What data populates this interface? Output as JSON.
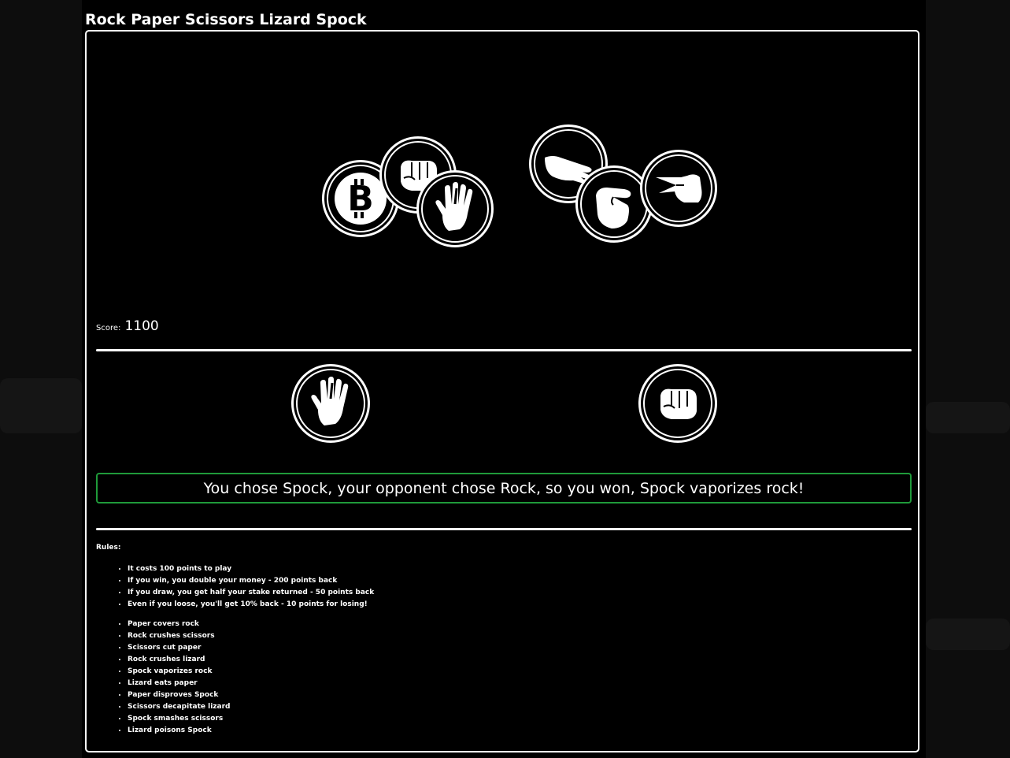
{
  "page": {
    "title": "Rock Paper Scissors Lizard Spock"
  },
  "choices": [
    {
      "name": "Bitcoin",
      "icon": "bitcoin-icon"
    },
    {
      "name": "Rock",
      "icon": "rock-fist-icon"
    },
    {
      "name": "Spock",
      "icon": "spock-hand-icon"
    },
    {
      "name": "Paper",
      "icon": "paper-hand-icon"
    },
    {
      "name": "Lizard",
      "icon": "lizard-hand-icon"
    },
    {
      "name": "Scissors",
      "icon": "scissors-hand-icon"
    }
  ],
  "score": {
    "label": "Score:",
    "value": "1100"
  },
  "round": {
    "player_choice_icon": "spock-hand-icon",
    "opponent_choice_icon": "rock-fist-icon",
    "result_message": "You chose Spock, your opponent chose Rock, so you won, Spock vaporizes rock!",
    "result_color": "#1f9a3a"
  },
  "rules": {
    "label": "Rules:",
    "payout": [
      "It costs 100 points to play",
      "If you win, you double your money - 200 points back",
      "If you draw, you get half your stake returned - 50 points back",
      "Even if you loose, you'll get 10% back - 10 points for losing!"
    ],
    "outcomes": [
      "Paper covers rock",
      "Rock crushes scissors",
      "Scissors cut paper",
      "Rock crushes lizard",
      "Spock vaporizes rock",
      "Lizard eats paper",
      "Paper disproves Spock",
      "Scissors decapitate lizard",
      "Spock smashes scissors",
      "Lizard poisons Spock"
    ]
  }
}
